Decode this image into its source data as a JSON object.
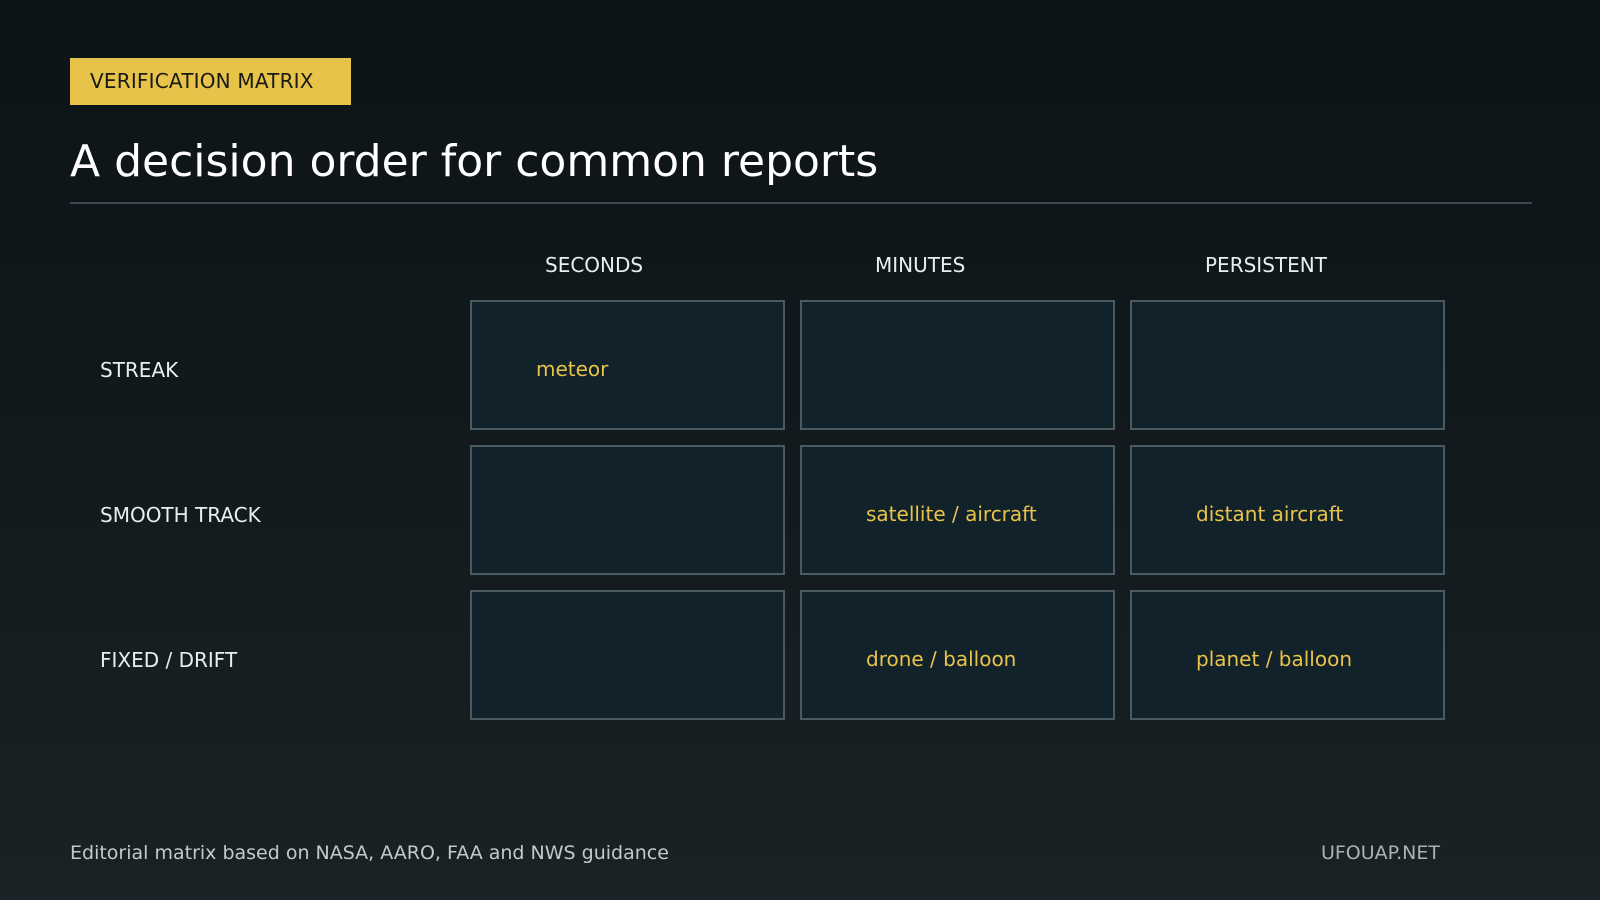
{
  "badge": "VERIFICATION MATRIX",
  "title": "A decision order for common reports",
  "columns": [
    "SECONDS",
    "MINUTES",
    "PERSISTENT"
  ],
  "rows": [
    {
      "label": "STREAK",
      "cells": [
        "meteor",
        "",
        ""
      ]
    },
    {
      "label": "SMOOTH TRACK",
      "cells": [
        "",
        "satellite / aircraft",
        "distant aircraft"
      ]
    },
    {
      "label": "FIXED / DRIFT",
      "cells": [
        "",
        "drone / balloon",
        "planet / balloon"
      ]
    }
  ],
  "footer": {
    "note": "Editorial matrix based on NASA, AARO, FAA and NWS guidance",
    "brand": "UFOUAP.NET"
  },
  "colors": {
    "accent": "#e8c34a",
    "background": "#0c1418",
    "cell_fill": "#12222a",
    "cell_border": "#4a5a60"
  }
}
